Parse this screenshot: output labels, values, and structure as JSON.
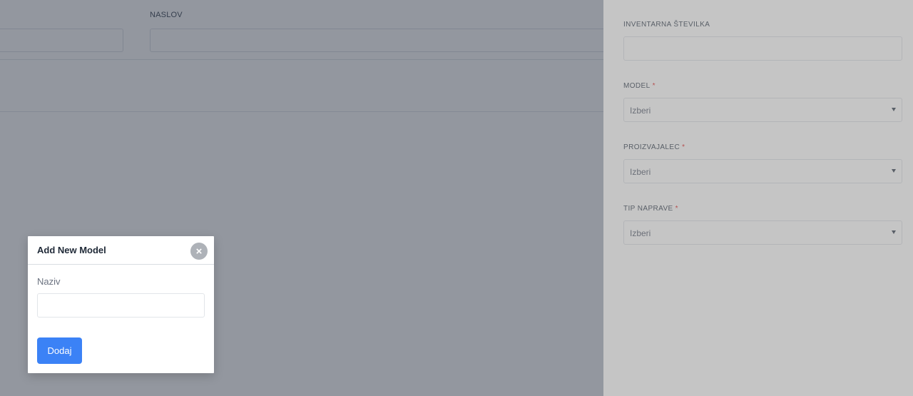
{
  "background_form": {
    "address_label": "NASLOV"
  },
  "side_panel": {
    "fields": [
      {
        "label": "INVENTARNA ŠTEVILKA",
        "required": false,
        "type": "text",
        "value": ""
      },
      {
        "label": "MODEL",
        "required": true,
        "type": "select",
        "value": "Izberi"
      },
      {
        "label": "PROIZVAJALEC",
        "required": true,
        "type": "select",
        "value": "Izberi"
      },
      {
        "label": "TIP NAPRAVE",
        "required": true,
        "type": "select",
        "value": "Izberi"
      }
    ],
    "required_marker": "*"
  },
  "modal": {
    "title": "Add New Model",
    "close_icon": "×",
    "name_label": "Naziv",
    "name_value": "",
    "submit_label": "Dodaj"
  },
  "colors": {
    "primary": "#3b82f6",
    "required": "#e53e3e",
    "overlay": "#1e2636"
  }
}
